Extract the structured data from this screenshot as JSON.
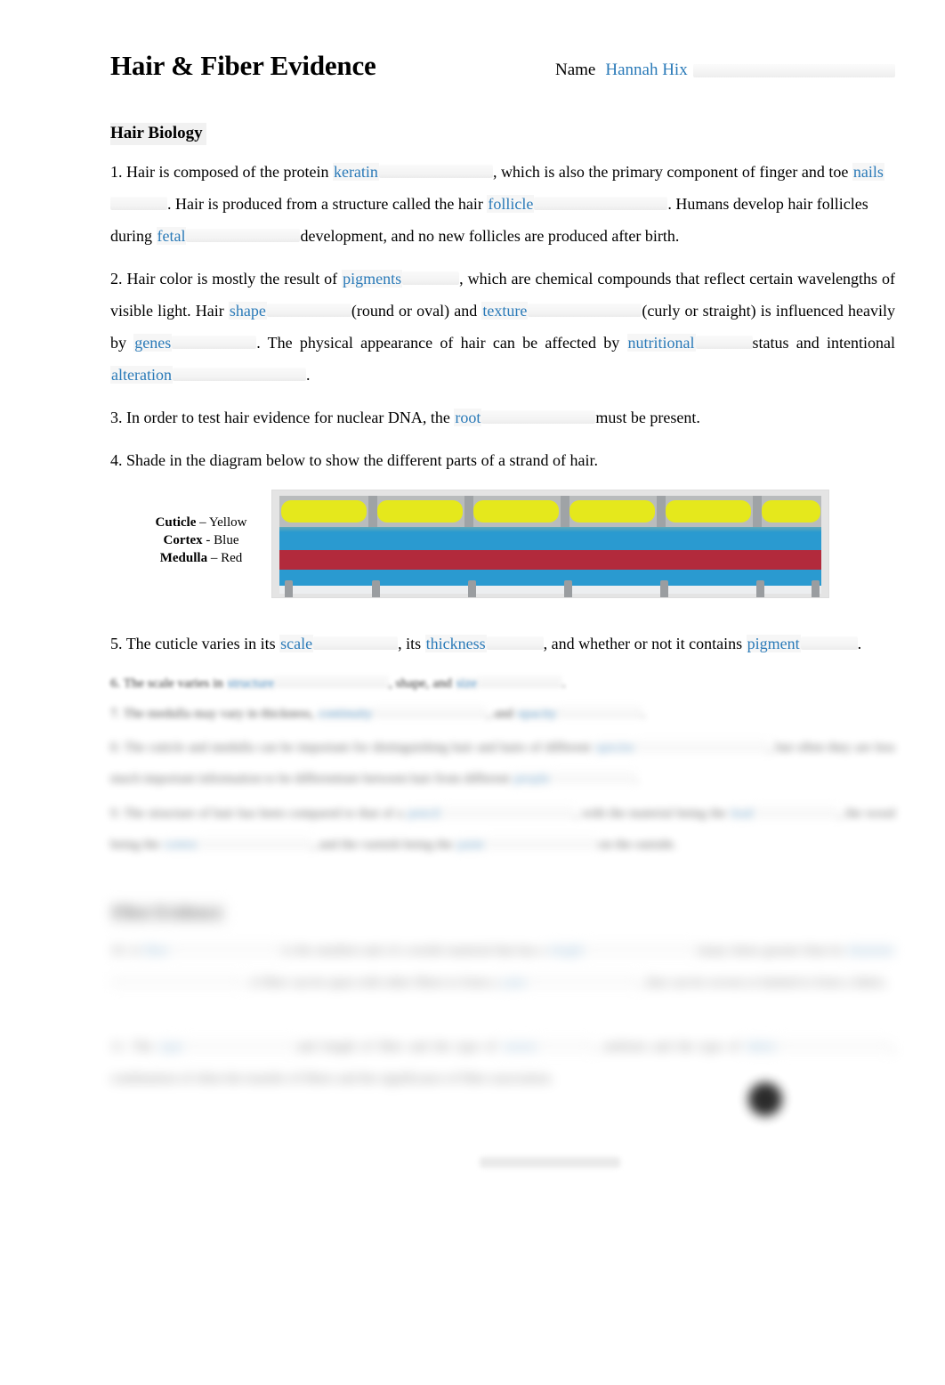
{
  "document": {
    "title": "Hair & Fiber Evidence",
    "name_label": "Name",
    "name_value": "Hannah Hix"
  },
  "sections": {
    "hair_biology": {
      "heading": "Hair Biology",
      "questions": {
        "q1": {
          "number": "1.",
          "t1": "Hair is composed of the protein",
          "a1": "keratin",
          "t2": ", which is also the primary component of finger and toe",
          "a2": "nails",
          "t3": ".  Hair is produced from a structure called the hair",
          "a3": "follicle",
          "t4": ". Humans develop hair follicles during",
          "a4": "fetal",
          "t5": "development, and no new follicles are produced after birth."
        },
        "q2": {
          "number": "2.",
          "t1": "Hair color is mostly the result of",
          "a1": "pigments",
          "t2": ", which are chemical compounds that reflect certain wavelengths of visible light.   Hair",
          "a2": "shape",
          "t3": "(round or oval) and",
          "a3": "texture",
          "t4": "(curly or straight) is influenced heavily by",
          "a4": "genes",
          "t5": ". The physical appearance of hair can be affected by",
          "a5": "nutritional",
          "t6": "status and intentional",
          "a6": "alteration",
          "t7": "."
        },
        "q3": {
          "number": "3.",
          "t1": "In order to test hair evidence for nuclear DNA, the",
          "a1": "root",
          "t2": "must be present."
        },
        "q4": {
          "number": "4.",
          "t1": "Shade in the diagram below to show the different parts of a strand of hair."
        },
        "q5": {
          "number": "5.",
          "t1": "The cuticle varies in its",
          "a1": "scale",
          "t2": ", its",
          "a2": "thickness",
          "t3": ", and whether or not it contains",
          "a3": "pigment",
          "t4": "."
        },
        "q6": {
          "number": "6.",
          "t1": "The scale varies in",
          "a1": "structure",
          "t2": ", shape, and",
          "a2": "size",
          "t3": "."
        },
        "q7": {
          "number": "7.",
          "t1": "The medulla may vary in thickness,",
          "a1": "continuity",
          "t2": ", and",
          "a2": "opacity",
          "t3": "."
        },
        "q8": {
          "number": "8.",
          "t1": "The cuticle and medulla can be important for distinguishing hair and hairs of different",
          "a1": "species",
          "t2": ", but often they are less much important information to be differentiate between hair from different",
          "a2": "people",
          "t3": "."
        },
        "q9": {
          "number": "9.",
          "t1": "The structure of hair has been compared to that of a",
          "a1": "pencil",
          "t2": ", with the material being the",
          "a2": "lead",
          "t3": ", the wood being the",
          "a3": "cortex",
          "t4": ", and the varnish being the",
          "a4": "paint",
          "t5": "on the outside."
        }
      },
      "diagram": {
        "legend": [
          {
            "part": "Cuticle",
            "dash": "–",
            "color": "Yellow"
          },
          {
            "part": "Cortex",
            "dash": "-",
            "color": "Blue"
          },
          {
            "part": "Medulla",
            "dash": "–",
            "color": "Red"
          }
        ],
        "colors": {
          "cuticle": "#e5e81c",
          "cortex": "#2a9ad0",
          "medulla": "#b22a3c",
          "background": "#e4e4e4",
          "base": "#eceef0"
        }
      }
    },
    "fiber_evidence": {
      "heading": "Fiber Evidence",
      "questions": {
        "q10": {
          "number": "10.",
          "t1": "A",
          "a1": "fiber",
          "t2": "is the smallest unit of a textile material that has a",
          "a2": "length",
          "t3": "many times greater than its",
          "a3": "diameter",
          "t4": ". A fiber can be spun with other fibers to form a",
          "a4": "yarn",
          "t5": ", that can be woven or knitted to form a fabric."
        },
        "q11": {
          "number": "11.",
          "t1": "The",
          "a1": "type",
          "t2": "and length of fiber and the type of",
          "a2": "weave",
          "t3": ", uniform and the type of",
          "a3": "fabric",
          "t4": ", combination of often the transfer of fibers and the significance of fiber association."
        }
      }
    }
  },
  "theme": {
    "fill_text_color": "#2a7ab8",
    "blank_fill": "#f3f3f3",
    "text_color": "#000000"
  }
}
